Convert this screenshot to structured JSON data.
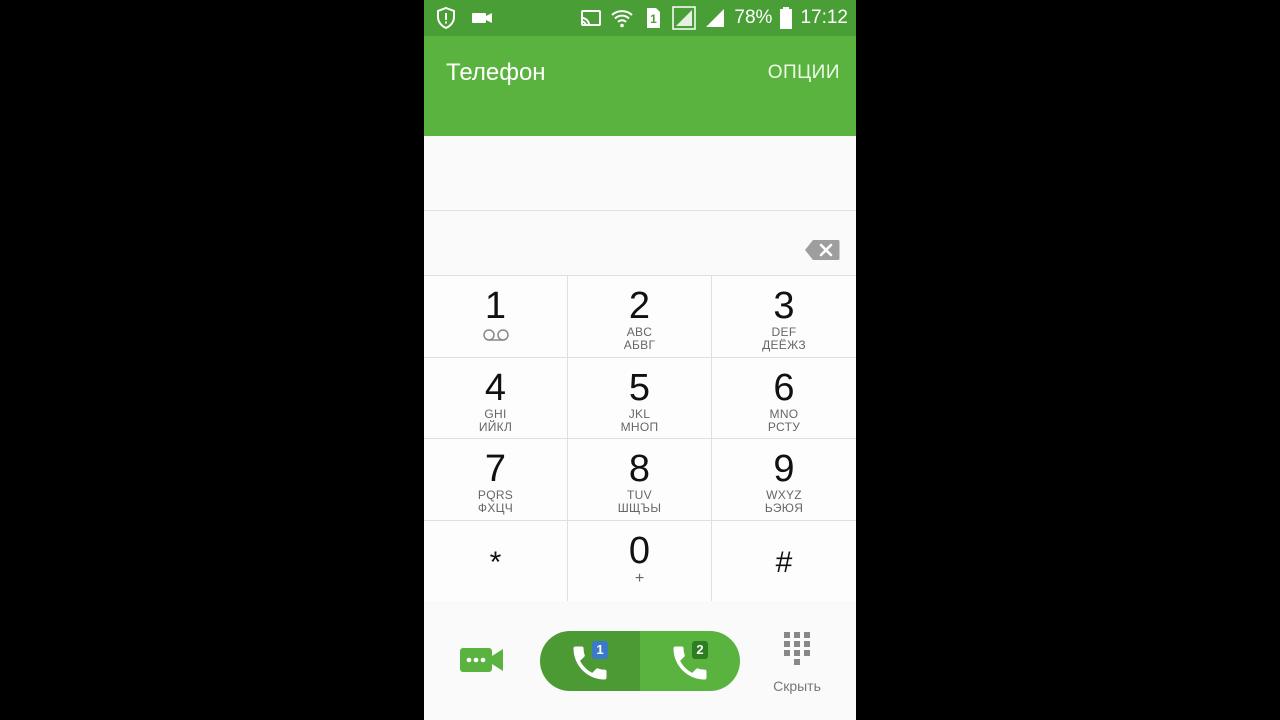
{
  "status_bar": {
    "battery": "78%",
    "time": "17:12",
    "sim_slot": "1"
  },
  "app_bar": {
    "title": "Телефон",
    "options": "ОПЦИИ"
  },
  "keypad": {
    "keys": [
      {
        "digit": "1",
        "sub1": "",
        "sub2": ""
      },
      {
        "digit": "2",
        "sub1": "ABC",
        "sub2": "АБВГ"
      },
      {
        "digit": "3",
        "sub1": "DEF",
        "sub2": "ДЕЁЖЗ"
      },
      {
        "digit": "4",
        "sub1": "GHI",
        "sub2": "ИЙКЛ"
      },
      {
        "digit": "5",
        "sub1": "JKL",
        "sub2": "МНОП"
      },
      {
        "digit": "6",
        "sub1": "MNO",
        "sub2": "РСТУ"
      },
      {
        "digit": "7",
        "sub1": "PQRS",
        "sub2": "ФХЦЧ"
      },
      {
        "digit": "8",
        "sub1": "TUV",
        "sub2": "ШЩЪЫ"
      },
      {
        "digit": "9",
        "sub1": "WXYZ",
        "sub2": "ЬЭЮЯ"
      },
      {
        "digit": "*"
      },
      {
        "digit": "0",
        "sub1": "+"
      },
      {
        "digit": "#"
      }
    ]
  },
  "bottom_bar": {
    "sim1_label": "1",
    "sim2_label": "2",
    "hide_label": "Скрыть"
  },
  "colors": {
    "status_bar": "#4a9e36",
    "app_bar": "#5bb33f",
    "call_sim1": "#4c9a34",
    "call_sim2": "#5bb33f",
    "sim1_badge": "#3b79c9",
    "sim2_badge": "#2e7d20"
  },
  "icons": {
    "status_left": [
      "shield-alert-icon",
      "video-camera-icon"
    ],
    "status_right": [
      "cast-icon",
      "wifi-icon",
      "sim-icon",
      "signal-icon",
      "battery-icon"
    ],
    "backspace": "backspace-icon",
    "voicemail": "voicemail-icon",
    "video_call": "video-call-icon",
    "call": "phone-icon",
    "hide": "dialpad-icon"
  }
}
